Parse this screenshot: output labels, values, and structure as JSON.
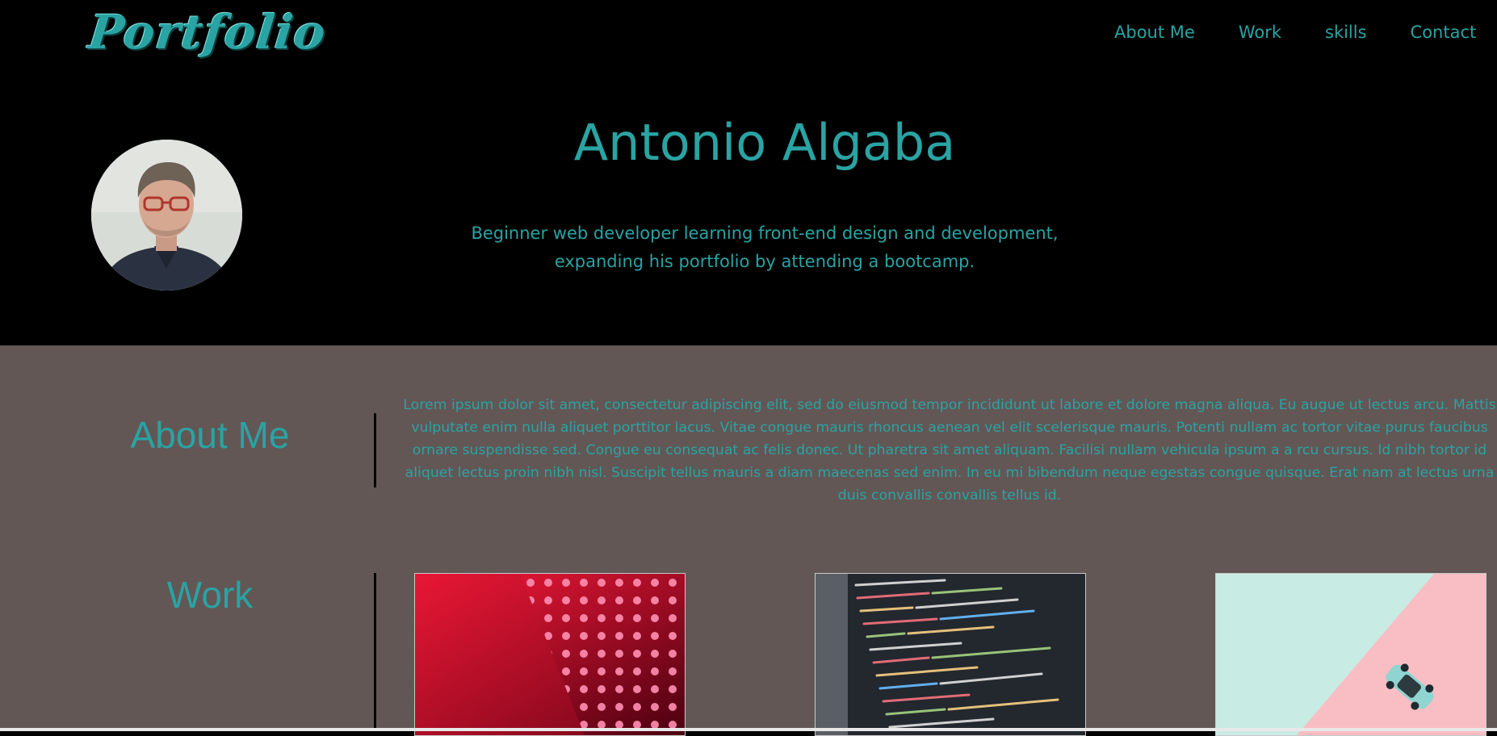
{
  "header": {
    "logo": "Portfolio",
    "nav": [
      "About Me",
      "Work",
      "skills",
      "Contact"
    ]
  },
  "hero": {
    "name": "Antonio Algaba",
    "subtitle_line1": "Beginner web developer learning front-end design and development,",
    "subtitle_line2": "expanding his portfolio by attending a bootcamp."
  },
  "about": {
    "title": "About Me",
    "text": "Lorem ipsum dolor sit amet, consectetur adipiscing elit, sed do eiusmod tempor incididunt ut labore et dolore magna aliqua. Eu augue ut lectus arcu. Mattis vulputate enim nulla aliquet porttitor lacus. Vitae congue mauris rhoncus aenean vel elit scelerisque mauris. Potenti nullam ac tortor vitae purus faucibus ornare suspendisse sed. Congue eu consequat ac felis donec. Ut pharetra sit amet aliquam. Facilisi nullam vehicula ipsum a a rcu cursus. Id nibh tortor id aliquet lectus proin nibh nisl. Suscipit tellus mauris a diam maecenas sed enim. In eu mi bibendum neque egestas congue quisque. Erat nam at lectus urna duis convallis convallis tellus id."
  },
  "work": {
    "title": "Work",
    "projects": [
      "red-led-wall-image",
      "code-screen-image",
      "toy-car-image"
    ]
  },
  "colors": {
    "accent": "#2aa3a3",
    "header_bg": "#000000",
    "main_bg": "#625755"
  }
}
